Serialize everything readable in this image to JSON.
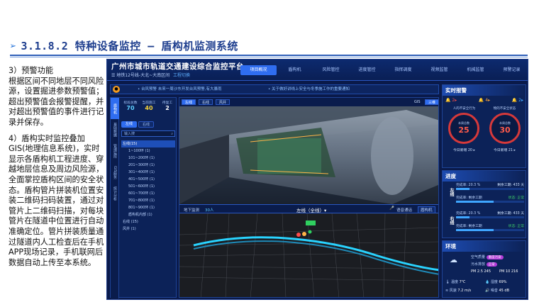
{
  "slide": {
    "heading": "3.1.8.2 特种设备监控 – 盾构机监测系统",
    "paragraphs": [
      "3）预警功能",
      "根据区间不同地层不同风险源，设置掘进参数预警值；超出预警值会报警提醒，并对超出预警值的事件进行记录并保存。",
      "4）盾构实时监控叠加GIS(地理信息系统)，实时显示各盾构机工程进度、穿越地层信息及周边风险源，全面掌控盾构区间的安全状态。盾构管片拼装机位置安装二维码扫码装置，通过对管片上二维码扫描，对每块管片在隧道中位置进行自动准确定位。管片拼装质量通过隧道内人工检查后在手机APP现场记录，手机联网后数据自动上传至本系统。"
    ]
  },
  "dashboard": {
    "title": "广州市城市轨道交通建设综合监控平台",
    "line_selector": "地铁12号线-大北~大南区间",
    "line_selector_btn": "工程切换",
    "nav": [
      "项目概况",
      "盾构机",
      "风险管控",
      "进度管控",
      "指挥调度",
      "视频监管",
      "机械监管",
      "预警记录"
    ],
    "nav_active": 0,
    "alert_bar": {
      "msg1": "• 台风预警  未来一周沙东开发台风预警,有大暴雨",
      "msg2": "• 关于做好讲线上安全与冬季施工作的重要通知"
    },
    "left": {
      "vtabs": [
        "盾构机",
        "基础数据",
        "管理监控",
        "GIS服务",
        "统计分析"
      ],
      "stats": [
        {
          "label": "标段总数",
          "value": "70"
        },
        {
          "label": "当前施工",
          "value": "40"
        },
        {
          "label": "待复工",
          "value": "2"
        }
      ],
      "pills": [
        "左线",
        "右线"
      ],
      "search_placeholder": "输入搜",
      "tree": [
        {
          "label": "左线(15)",
          "selected": true,
          "sub": false
        },
        {
          "label": "1~100环 (1)",
          "selected": false,
          "sub": true
        },
        {
          "label": "101~200环 (1)",
          "selected": false,
          "sub": true
        },
        {
          "label": "201~300环 (1)",
          "selected": false,
          "sub": true
        },
        {
          "label": "301~400环 (1)",
          "selected": false,
          "sub": true
        },
        {
          "label": "401~500环 (1)",
          "selected": false,
          "sub": true
        },
        {
          "label": "501~600环 (1)",
          "selected": false,
          "sub": true
        },
        {
          "label": "601~700环 (1)",
          "selected": false,
          "sub": true
        },
        {
          "label": "701~800环 (1)",
          "selected": false,
          "sub": true
        },
        {
          "label": "801~900环 (1)",
          "selected": false,
          "sub": true
        },
        {
          "label": "盾构机内部 (1)",
          "selected": false,
          "sub": true
        },
        {
          "label": "右线 (15)",
          "selected": false,
          "sub": false
        },
        {
          "label": "风井 (1)",
          "selected": false,
          "sub": false
        }
      ]
    },
    "viewer": {
      "tabs": [
        "左线",
        "右线",
        "风井"
      ],
      "btn_gis": "GIS",
      "btn_3d": "三维",
      "mid_label": "地下监测",
      "mid_value": "30人",
      "mid_title": "左线（全线）▾",
      "mid_voice": "语音通话",
      "mid_btn": "盾构机"
    },
    "right": {
      "realtime": {
        "title": "实时报警",
        "counts": [
          {
            "color": "#e84a4a",
            "value": "2▸"
          },
          {
            "color": "#f5a03a",
            "value": "4▸"
          },
          {
            "color": "#3fa6ff",
            "value": "2▸"
          }
        ],
        "gauge_titles": [
          "人的不安全行为",
          "物的不安全状态"
        ],
        "gauges": [
          {
            "label": "本周总数",
            "value": "25",
            "foot": "今日新增 20 ▸"
          },
          {
            "label": "本周总数",
            "value": "30",
            "foot": "今日新增 21 ▸"
          }
        ]
      },
      "progress": {
        "title": "进度",
        "rows": [
          {
            "side": "左线",
            "items": [
              {
                "label": "完成率: 20.3 %",
                "extra": "剩余工期: 433 天",
                "pct": 20.3
              },
              {
                "label": "完成率: 剩余工期",
                "extra": "状态: 正常",
                "pct": 55
              }
            ]
          },
          {
            "side": "右线",
            "items": [
              {
                "label": "完成率: 20.3 %",
                "extra": "剩余工期: 433 天",
                "pct": 20.3
              },
              {
                "label": "完成率: 剩余工期",
                "extra": "状态: 正常",
                "pct": 55
              }
            ]
          }
        ]
      },
      "environment": {
        "title": "环境",
        "air_label": "空气质量",
        "air_badge": "重度污染",
        "water_label": "污水排放",
        "water_badge": "正常",
        "pm25": "PM 2.5 245",
        "pm10": "PM 10 216",
        "temp_label": "温度",
        "temp": "7℃",
        "humidity_label": "湿度",
        "humidity": "69%",
        "wind_label": "风速",
        "wind": "7.2 m/s",
        "noise_label": "噪音",
        "noise": "45 dB"
      }
    }
  }
}
